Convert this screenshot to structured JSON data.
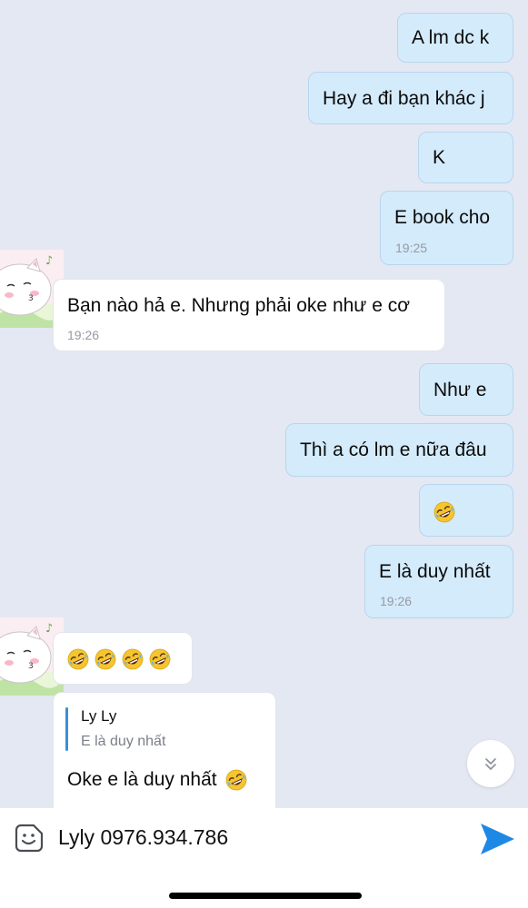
{
  "messages": {
    "m1": {
      "text": "A lm dc k"
    },
    "m2": {
      "text": "Hay a đi bạn khác j"
    },
    "m3": {
      "text": "K"
    },
    "m4": {
      "text": "E book cho",
      "time": "19:25"
    },
    "m5": {
      "text": "Bạn nào hả e. Nhưng phải oke như e cơ",
      "time": "19:26"
    },
    "m6": {
      "text": "Như e"
    },
    "m7": {
      "text": "Thì a có lm e nữa đâu"
    },
    "m8": {
      "emoji": "rofl-emoji"
    },
    "m9": {
      "text": "E là duy nhất",
      "time": "19:26"
    },
    "m10": {
      "emoji_count": 4,
      "emoji": "rofl-emoji"
    },
    "m11": {
      "quote_name": "Ly Ly",
      "quote_text": "E là duy nhất",
      "text": "Oke e là duy nhất"
    }
  },
  "composer": {
    "value": "Lyly 0976.934.786",
    "sticker_icon": "sticker-icon",
    "send_icon": "send-icon"
  },
  "colors": {
    "background": "#e4e8f2",
    "outgoing_bubble": "#d4ebfb",
    "incoming_bubble": "#ffffff",
    "accent": "#1e88e5"
  }
}
